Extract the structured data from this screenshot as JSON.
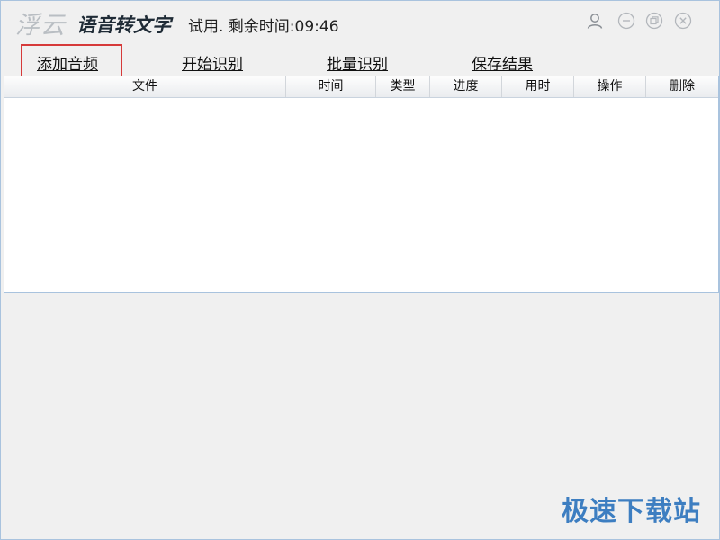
{
  "titlebar": {
    "logo": "浮云",
    "app_title": "语音转文字",
    "trial_text": "试用. 剩余时间:09:46",
    "icons": [
      "user-icon",
      "minimize-icon",
      "restore-icon",
      "close-icon"
    ]
  },
  "toolbar": {
    "add_audio": "添加音频",
    "start_recognition": "开始识别",
    "batch_recognition": "批量识别",
    "save_results": "保存结果"
  },
  "table": {
    "headers": [
      "文件",
      "时间",
      "类型",
      "进度",
      "用时",
      "操作",
      "删除"
    ],
    "rows": []
  },
  "watermark": "极速下载站",
  "colors": {
    "window_border": "#a9c3de",
    "highlight": "#d63a3a",
    "watermark": "#3d7ec1",
    "background": "#f0f0f0"
  }
}
